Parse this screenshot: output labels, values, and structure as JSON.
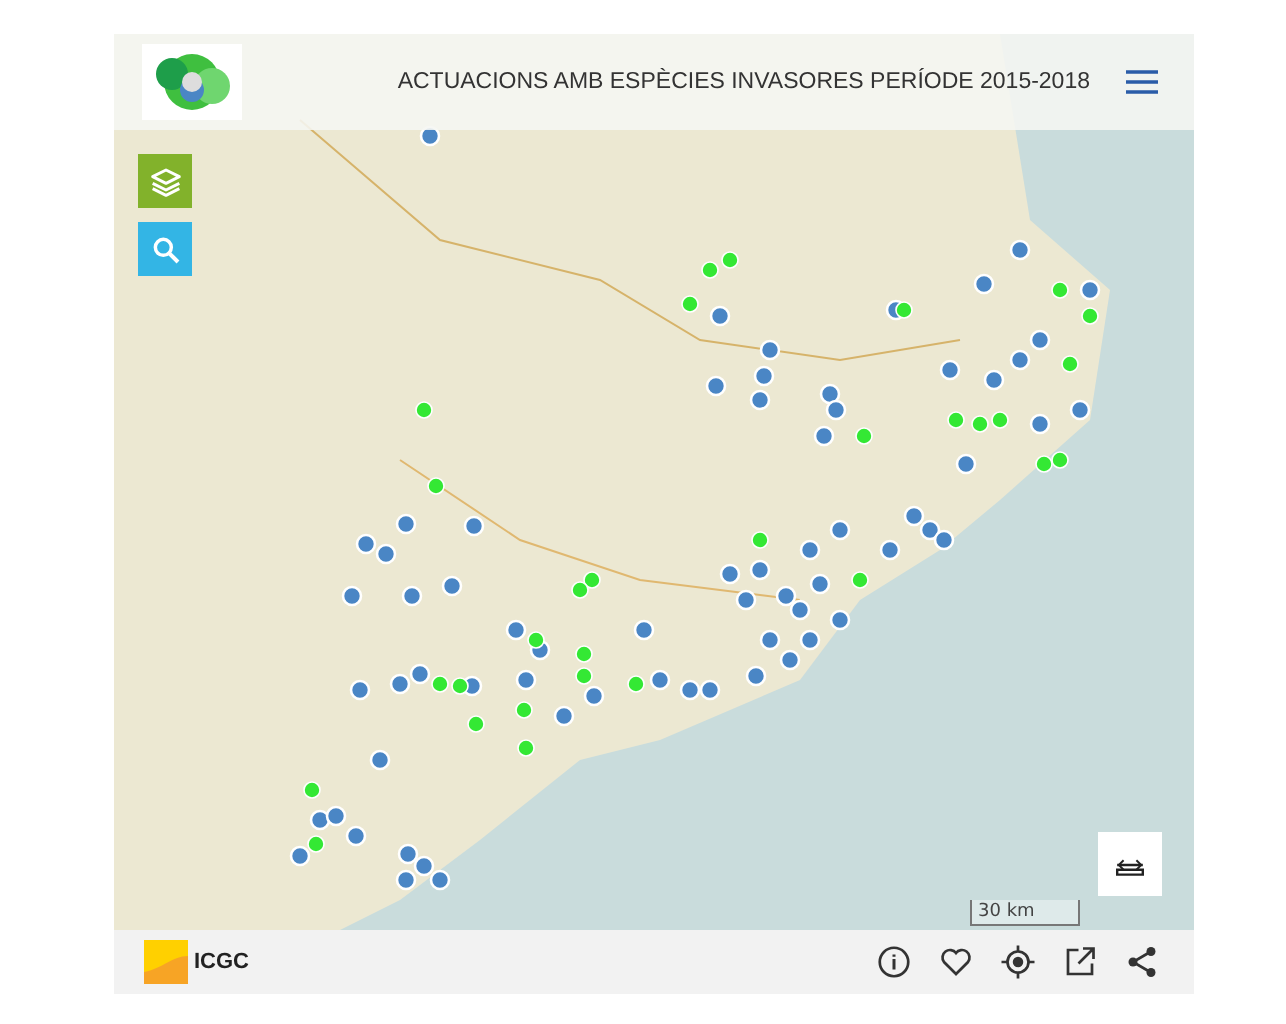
{
  "header": {
    "title": "ACTUACIONS AMB ESPÈCIES INVASORES PERÍODE 2015-2018"
  },
  "map_controls": [
    {
      "kind": "layers"
    },
    {
      "kind": "search"
    }
  ],
  "scale": {
    "label": "30 km"
  },
  "footer": {
    "brand": "ICGC",
    "actions": [
      {
        "kind": "info"
      },
      {
        "kind": "favorite"
      },
      {
        "kind": "locate"
      },
      {
        "kind": "open"
      },
      {
        "kind": "share"
      }
    ]
  }
}
